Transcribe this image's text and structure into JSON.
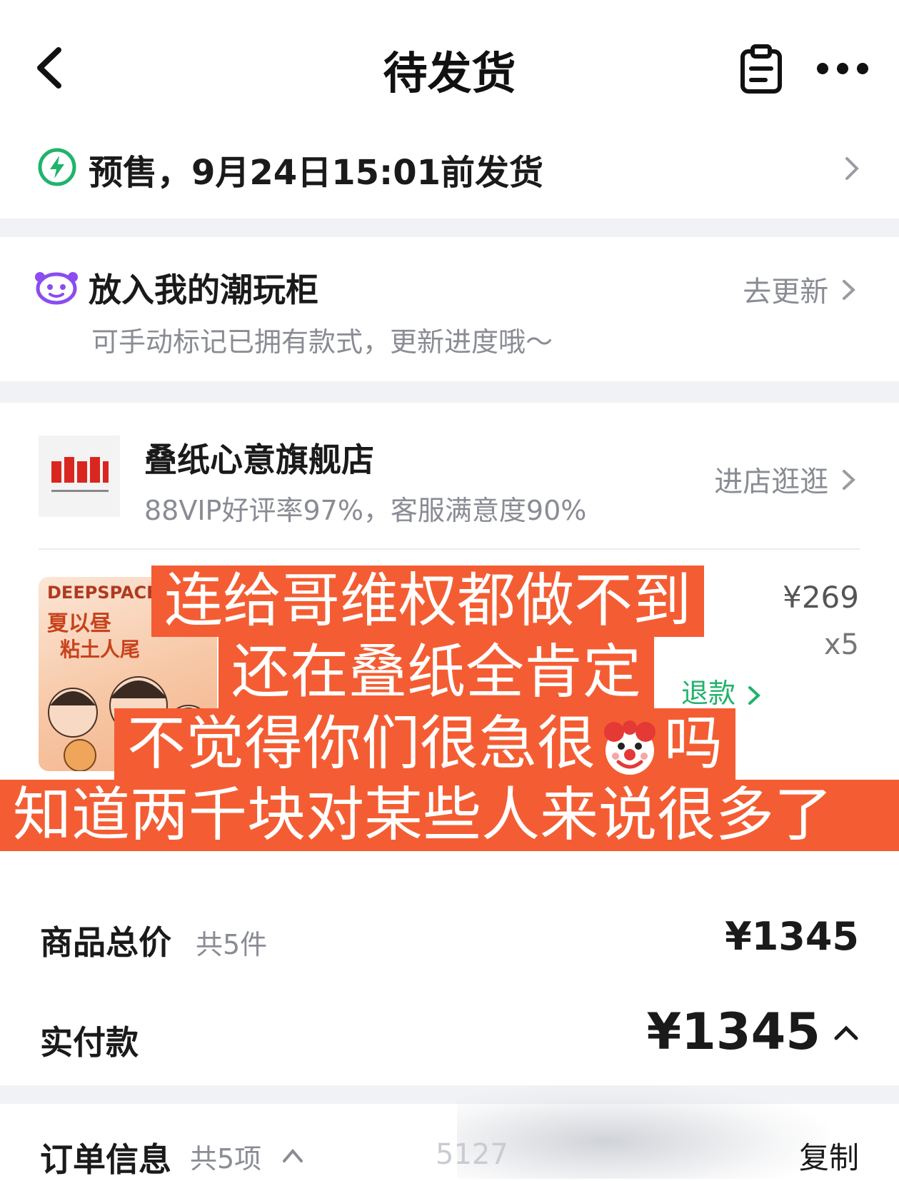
{
  "header": {
    "title": "待发货",
    "back_icon": "chevron-left-icon",
    "order_icon": "clipboard-icon",
    "more_icon": "more-dots-icon"
  },
  "presale": {
    "text": "预售，9月24日15:01前发货",
    "icon": "lightning-icon",
    "icon_color": "#1fb46b"
  },
  "cabinet": {
    "title": "放入我的潮玩柜",
    "subtitle": "可手动标记已拥有款式，更新进度哦～",
    "action": "去更新",
    "icon": "mascot-icon",
    "icon_color": "#8b4cf0"
  },
  "store": {
    "name": "叠纸心意旗舰店",
    "rating": "88VIP好评率97%，客服满意度90%",
    "action": "进店逛逛",
    "logo_color": "#d9271f"
  },
  "product": {
    "image_texts": [
      "DEEPSPACE",
      "夏以昼",
      "粘土人尾"
    ],
    "price": "¥269",
    "quantity": "x5",
    "refund": "退款"
  },
  "caption": {
    "line1": "连给哥维权都做不到",
    "line2": "还在叠纸全肯定",
    "line3_before": "不觉得你们很急很",
    "line3_after": "吗",
    "line4": "知道两千块对某些人来说很多了",
    "background": "#f45d33"
  },
  "totals": {
    "goods_label": "商品总价",
    "goods_count": "共5件",
    "goods_value": "¥1345",
    "paid_label": "实付款",
    "paid_value": "¥1345"
  },
  "order_info": {
    "label": "订单信息",
    "count": "共5项",
    "number_partial": "5127",
    "copy": "复制"
  }
}
